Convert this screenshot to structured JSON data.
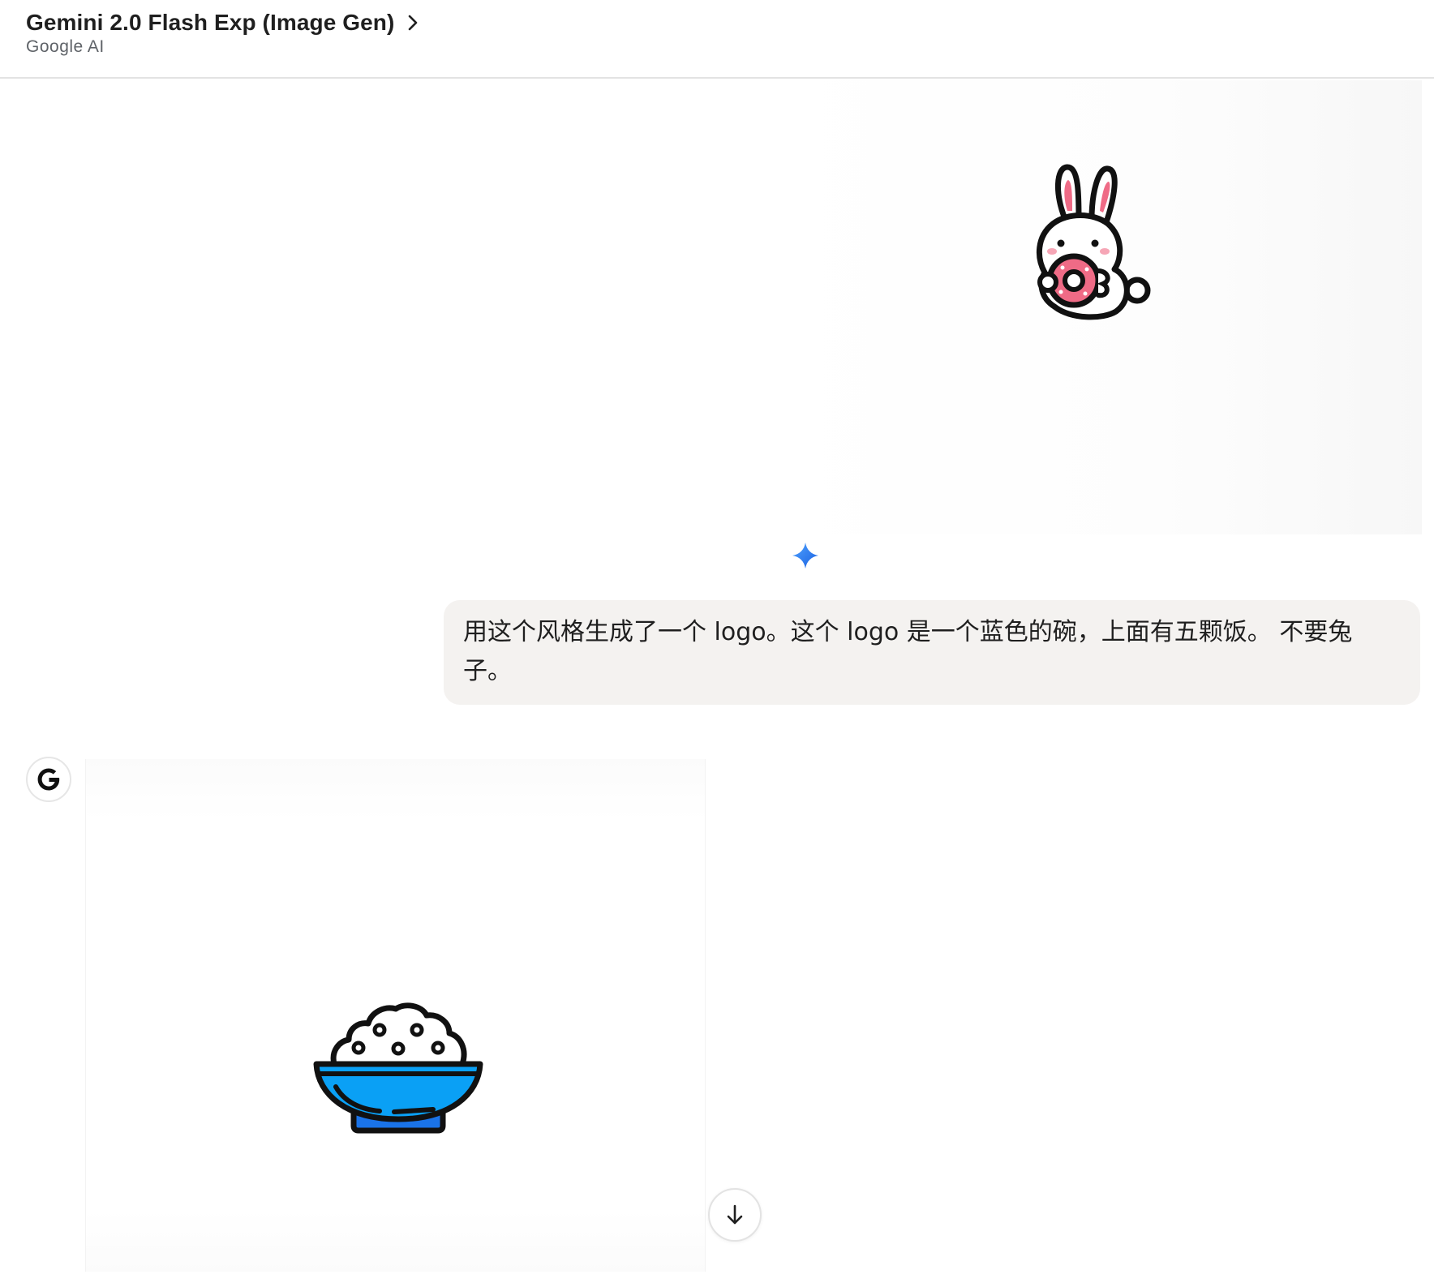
{
  "header": {
    "model_name": "Gemini 2.0 Flash Exp (Image Gen)",
    "provider": "Google AI",
    "chevron_icon": "chevron-right-icon"
  },
  "conversation": {
    "user_attachment": {
      "icon": "rabbit-holding-donut-image"
    },
    "assistant_marker_icon": "gemini-spark-icon",
    "user_message": {
      "text": "用这个风格生成了一个 logo。这个 logo 是一个蓝色的碗，上面有五颗饭。 不要兔子。"
    },
    "assistant": {
      "avatar_icon": "google-g-icon",
      "generated_image": "blue-rice-bowl-logo-image"
    }
  },
  "controls": {
    "scroll_down_icon": "arrow-down-icon"
  },
  "colors": {
    "bowl_blue": "#0aa0f5",
    "bowl_base_blue": "#1a73e8",
    "bubble_bg": "#f4f2f0",
    "rabbit_pink": "#ef6b86",
    "spark_blue": "#4285f4"
  }
}
